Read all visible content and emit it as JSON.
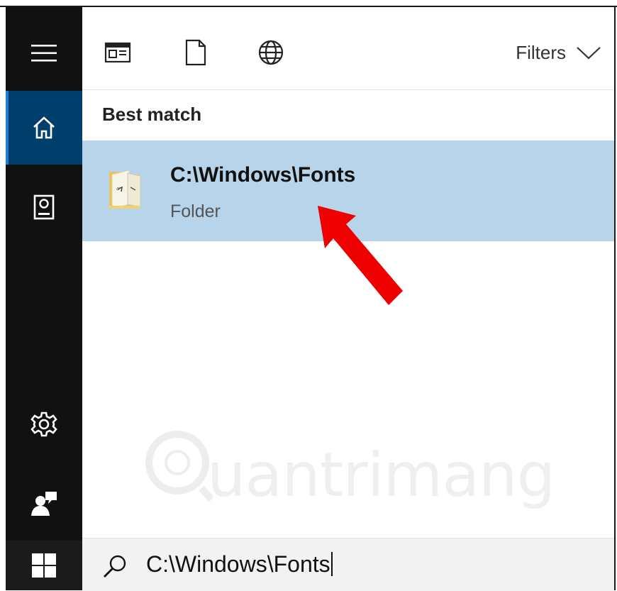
{
  "rail": {
    "items": [
      {
        "name": "menu",
        "icon": "hamburger-icon"
      },
      {
        "name": "home",
        "icon": "home-icon",
        "selected": true
      },
      {
        "name": "notebook",
        "icon": "notebook-icon"
      },
      {
        "name": "settings",
        "icon": "gear-icon"
      },
      {
        "name": "feedback",
        "icon": "feedback-icon"
      },
      {
        "name": "start",
        "icon": "windows-logo-icon"
      }
    ],
    "accent": "#003e6b"
  },
  "topbar": {
    "icons": [
      "apps-icon",
      "document-icon",
      "globe-icon"
    ],
    "filters_label": "Filters"
  },
  "results": {
    "section_header": "Best match",
    "best_match": {
      "title": "C:\\Windows\\Fonts",
      "subtitle": "Folder",
      "icon": "folder-icon",
      "highlight": "#b8d4ea"
    }
  },
  "annotation": {
    "icon": "red-arrow",
    "color": "#ee0000"
  },
  "watermark": {
    "text": "uantrimang",
    "opacity": 0.35
  },
  "search": {
    "value": "C:\\Windows\\Fonts",
    "icon": "search-icon"
  }
}
